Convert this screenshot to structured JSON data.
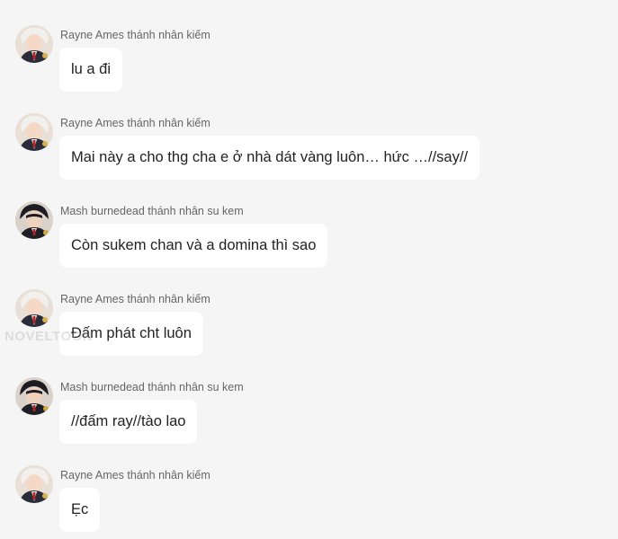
{
  "messages": [
    {
      "avatar": "rayne-avatar",
      "sender": "Rayne Ames thánh nhân kiếm",
      "text": "lu a đi"
    },
    {
      "avatar": "rayne-avatar",
      "sender": "Rayne Ames thánh nhân kiếm",
      "text": "Mai này a cho thg cha e ở nhà dát vàng luôn… hức …//say//"
    },
    {
      "avatar": "mash-avatar",
      "sender": "Mash burnedead thánh nhân su kem",
      "text": "Còn sukem chan và a domina thì sao"
    },
    {
      "avatar": "rayne-avatar",
      "sender": "Rayne Ames thánh nhân kiếm",
      "text": "Đấm phát cht luôn"
    },
    {
      "avatar": "mash-avatar",
      "sender": "Mash burnedead thánh nhân su kem",
      "text": "//đấm ray//tào lao"
    },
    {
      "avatar": "rayne-avatar",
      "sender": "Rayne Ames thánh nhân kiếm",
      "text": "Ẹc"
    }
  ],
  "watermark": "NOVELTOON",
  "colors": {
    "background": "#f5f5f5",
    "bubble": "#ffffff",
    "name_text": "#666666",
    "message_text": "#222222"
  }
}
